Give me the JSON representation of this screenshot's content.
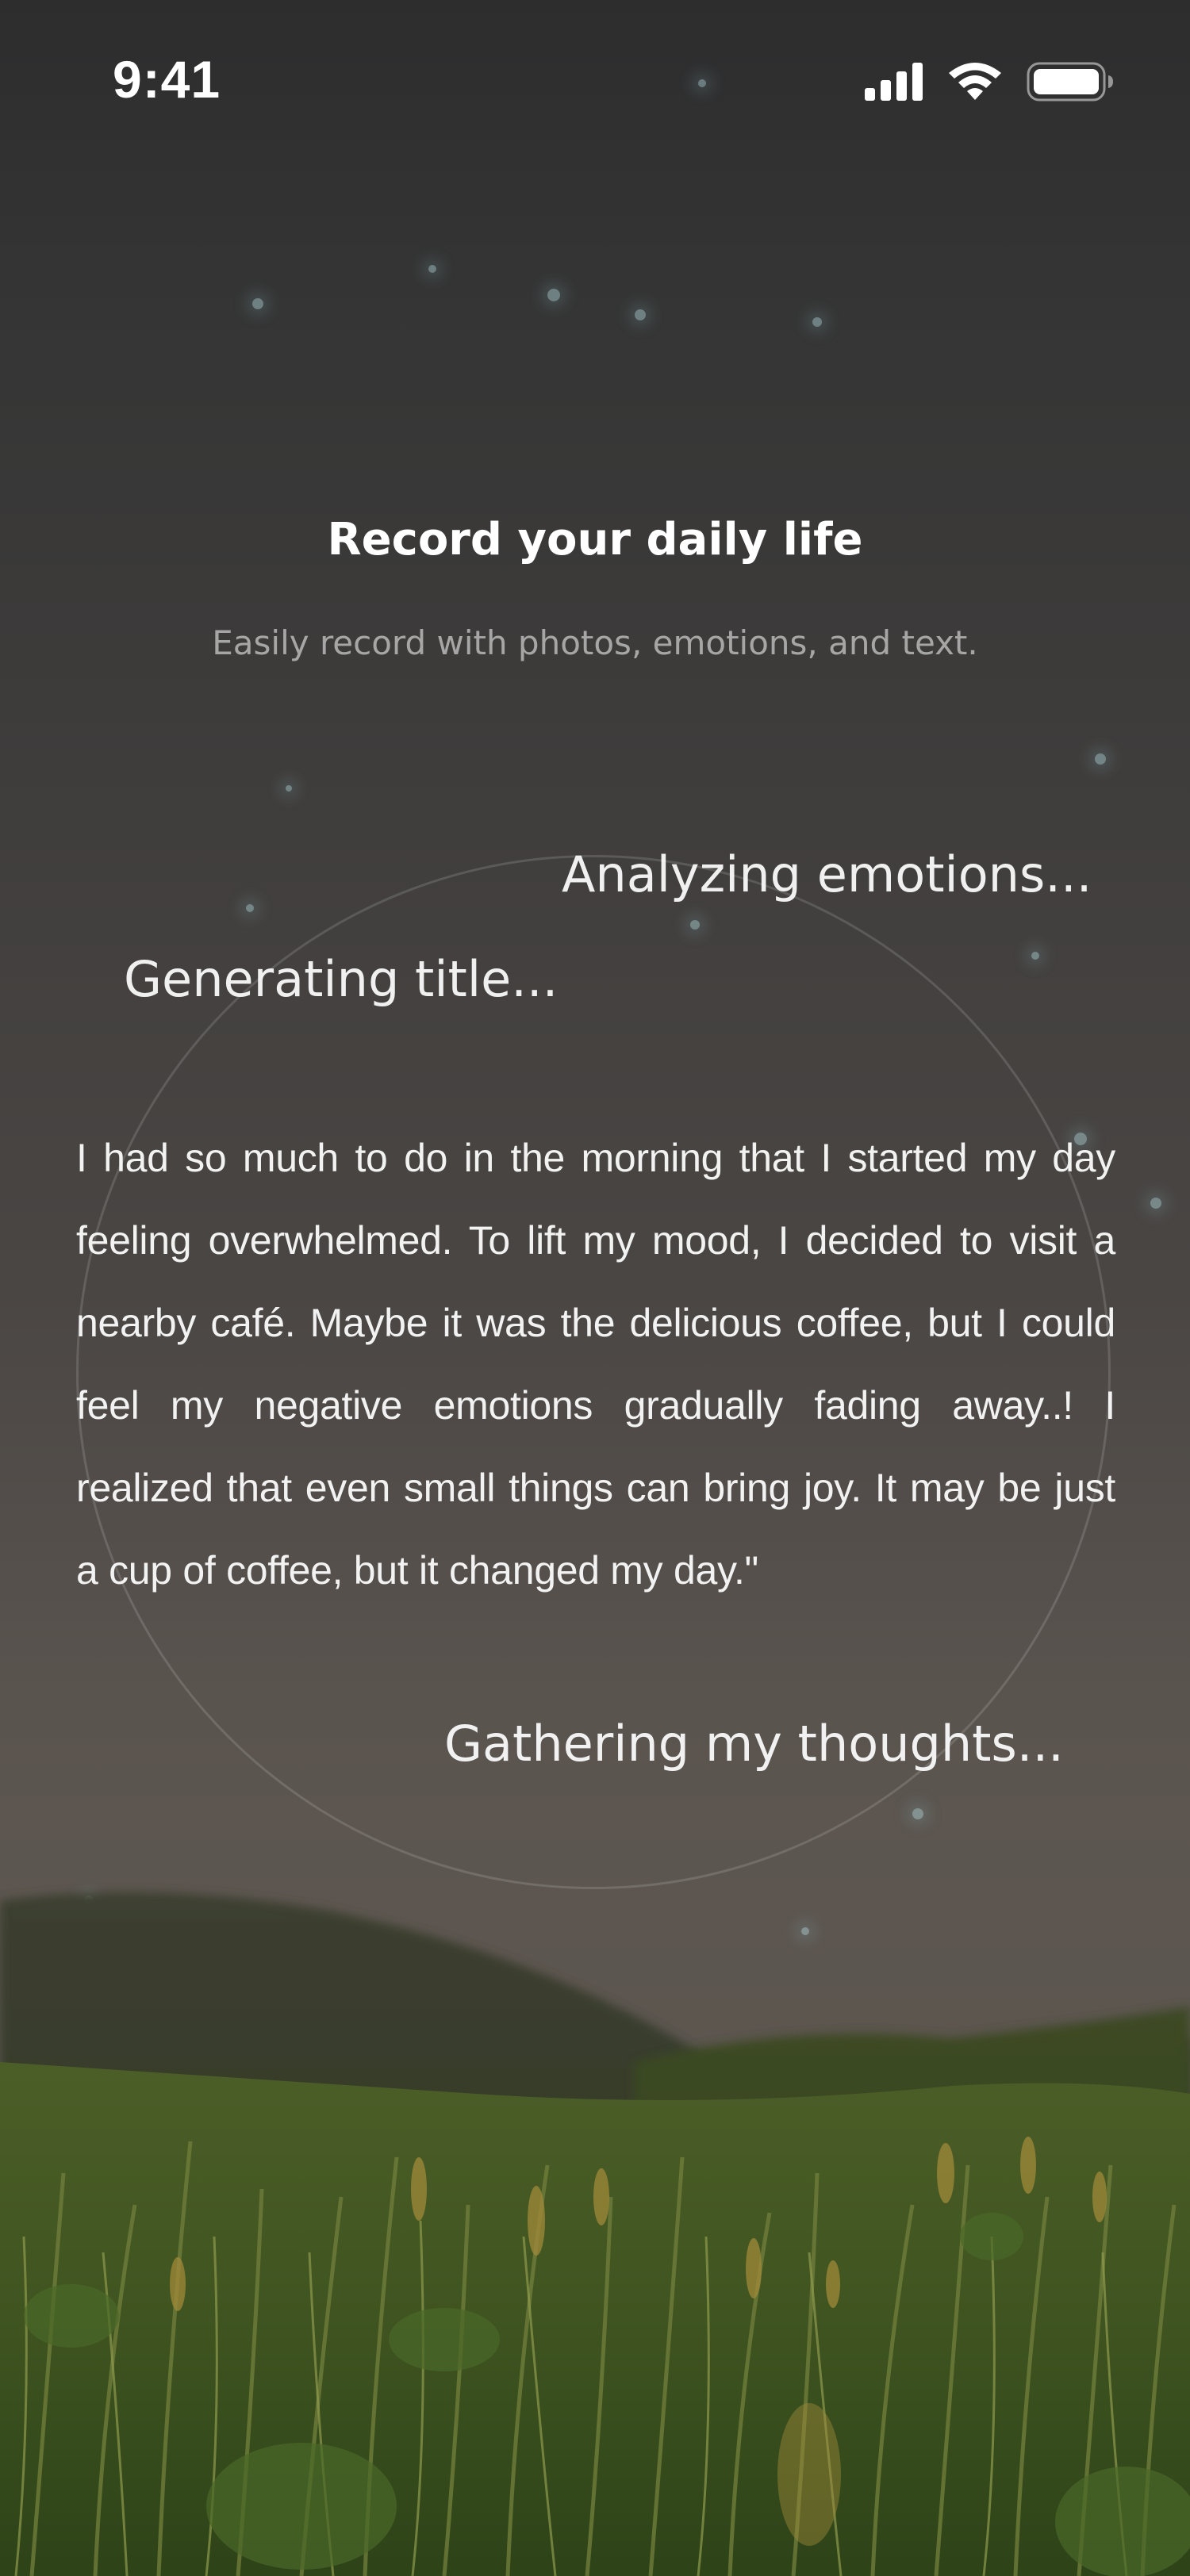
{
  "status_bar": {
    "time": "9:41",
    "icons": [
      "cellular-signal-icon",
      "wifi-icon",
      "battery-icon"
    ]
  },
  "header": {
    "title": "Record your daily life",
    "subtitle": "Easily record with photos, emotions, and text."
  },
  "processing": {
    "emotions_label": "Analyzing emotions...",
    "title_label": "Generating title...",
    "thoughts_label": "Gathering my thoughts..."
  },
  "diary": {
    "text": "I had so much to do in the morning that I started my day feeling overwhelmed. To lift my mood, I decided to visit a nearby café. Maybe it was the delicious coffee, but I could feel my negative emotions gradually fading away..! I realized that even small things can bring joy. It may be just a cup of coffee, but it changed my day.\""
  },
  "colors": {
    "background_top": "#2d2d2e",
    "background_bottom": "#5d5650",
    "text": "#ffffff",
    "grass": "#4a5a2a"
  }
}
